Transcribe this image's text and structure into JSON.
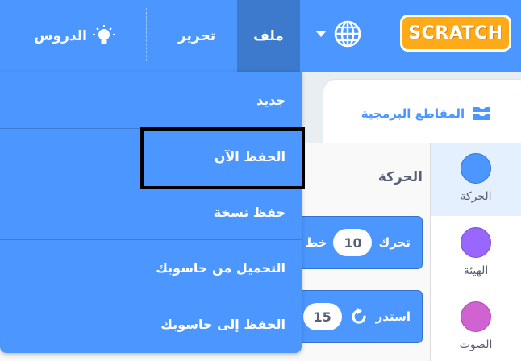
{
  "app": {
    "logo_text": "SCRATCH"
  },
  "menubar": {
    "file_label": "ملف",
    "edit_label": "تحرير",
    "tutorials_label": "الدروس",
    "language_icon": "globe-icon",
    "tutorials_icon": "lightbulb-icon"
  },
  "file_menu": {
    "items": [
      {
        "label": "جديد"
      },
      {
        "label": "الحفظ الآن"
      },
      {
        "label": "حفظ نسخة"
      },
      {
        "label": "التحميل من حاسوبك"
      },
      {
        "label": "الحفظ إلى حاسوبك"
      }
    ]
  },
  "tabs": {
    "code_label": "المقاطع البرمجية",
    "code_icon": "code-blocks-icon"
  },
  "categories": [
    {
      "label": "الحركة",
      "color": "#4c97ff"
    },
    {
      "label": "الهيئة",
      "color": "#9966ff"
    },
    {
      "label": "الصوت",
      "color": "#cf63cf"
    }
  ],
  "palette": {
    "section_title": "الحركة",
    "blocks": [
      {
        "text": "تحرك",
        "value": "10",
        "suffix": "خط"
      },
      {
        "text": "استدر",
        "value": "15"
      }
    ]
  },
  "colors": {
    "menubar": "#4c97ff",
    "menu_active": "#3d79cc",
    "logo": "#ffab19",
    "highlight": "#000000"
  }
}
